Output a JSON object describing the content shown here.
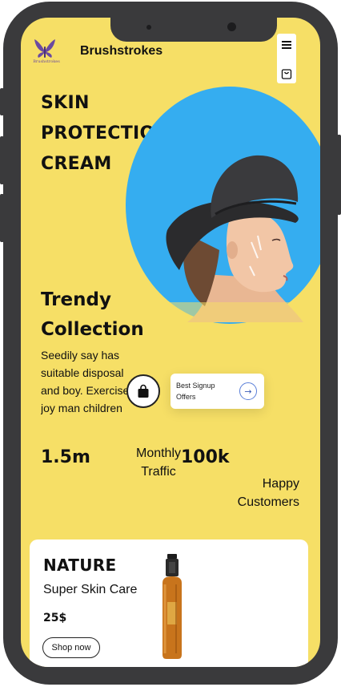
{
  "header": {
    "brand_name": "Brushstrokes",
    "logo_text": "Brushstrokes",
    "logo_icon": "butterfly-logo-icon",
    "menu_icon": "hamburger-menu-icon",
    "cart_icon": "shopping-bag-icon"
  },
  "hero": {
    "title_lines": [
      "SKIN",
      "PROTECTION",
      "CREAM"
    ],
    "circle_color": "#35adf0",
    "image": "woman-in-black-hat"
  },
  "collection": {
    "title_lines": [
      "Trendy",
      "Collection"
    ],
    "description_lines": [
      "Seedily say has",
      "suitable disposal",
      "and boy. Exercise",
      "joy man children"
    ]
  },
  "signup": {
    "bag_icon": "shopping-bag-icon",
    "offer_lines": [
      "Best Signup",
      "Offers"
    ],
    "arrow_icon": "arrow-right-icon",
    "arrow_glyph": "→"
  },
  "stats": [
    {
      "value": "1.5m",
      "label_lines": [
        "Monthly",
        "Traffic"
      ]
    },
    {
      "value": "100k",
      "label_lines": [
        "Happy",
        "Customers"
      ]
    }
  ],
  "product_card": {
    "title": "NATURE",
    "subtitle": "Super Skin Care",
    "price": "25$",
    "button_label": "Shop now",
    "image": "spray-bottle"
  },
  "colors": {
    "background": "#f6df66",
    "phone_frame": "#3a3a3c",
    "accent_blue": "#35adf0"
  }
}
